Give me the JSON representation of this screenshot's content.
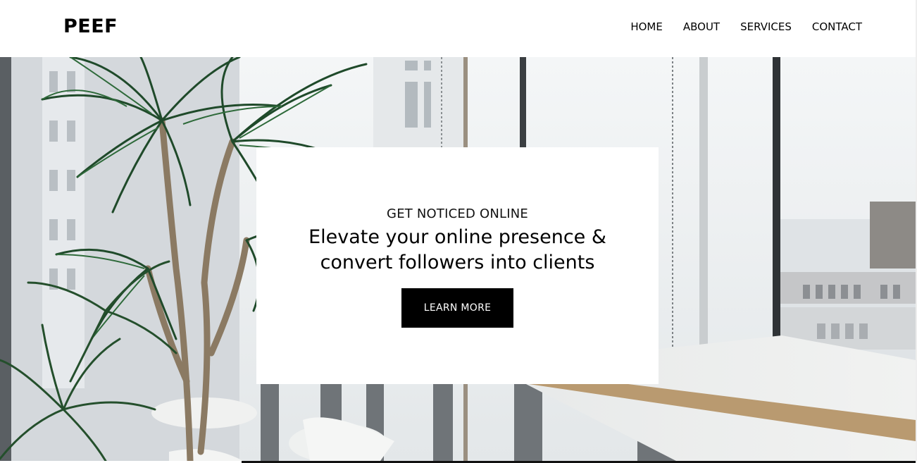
{
  "header": {
    "logo": "PEEF",
    "nav": [
      "HOME",
      "ABOUT",
      "SERVICES",
      "CONTACT"
    ]
  },
  "hero": {
    "eyebrow": "GET NOTICED ONLINE",
    "headline_line1": "Elevate your online presence &",
    "headline_line2": "convert followers into clients",
    "cta_label": "LEARN MORE"
  },
  "colors": {
    "background": "#ffffff",
    "text": "#000000",
    "button": "#000000",
    "button_text": "#ffffff"
  }
}
